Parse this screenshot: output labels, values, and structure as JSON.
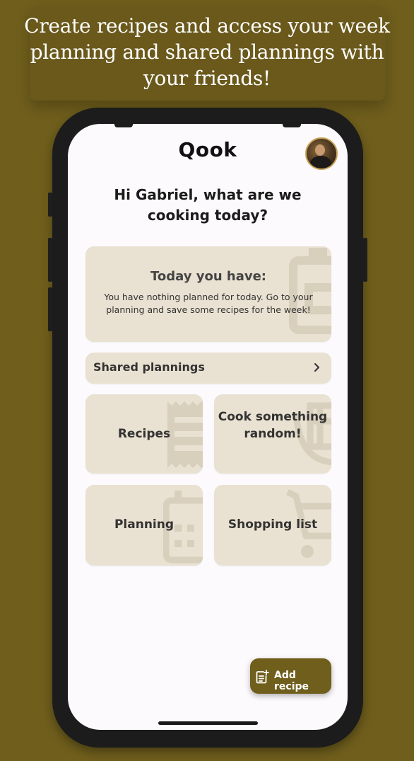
{
  "banner": {
    "headline": "Create recipes and access your week planning and shared plannings with your friends!"
  },
  "app": {
    "title": "Qook",
    "greeting": "Hi Gabriel, what are we cooking today?",
    "today": {
      "title": "Today you have:",
      "message": "You have nothing planned for today. Go to your planning and save some recipes for the week!"
    },
    "shared_plannings": {
      "label": "Shared plannings"
    },
    "tiles": {
      "recipes": "Recipes",
      "random": "Cook something random!",
      "planning": "Planning",
      "shopping": "Shopping list"
    },
    "add_recipe": {
      "label": "Add recipe"
    }
  },
  "colors": {
    "background": "#6f5e1c",
    "card": "#e9e1d1",
    "screen": "#fcfafc",
    "accent": "#6f5e1c"
  },
  "icons": {
    "today_card_bg": "clipboard-icon",
    "shared_chevron": "chevron-right-icon",
    "recipes_bg": "receipt-icon",
    "random_bg": "dish-icon",
    "planning_bg": "calendar-icon",
    "shopping_bg": "cart-icon",
    "add_recipe": "note-add-icon",
    "avatar": "avatar"
  }
}
